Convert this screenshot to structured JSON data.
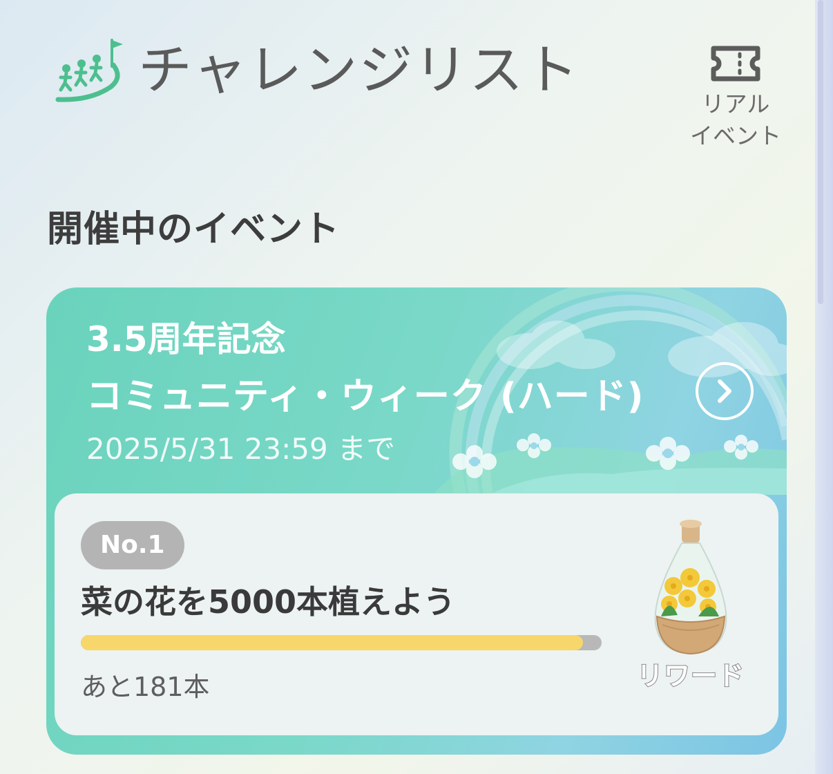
{
  "header": {
    "title": "チャレンジリスト",
    "real_event_label": "リアル\nイベント"
  },
  "section": {
    "title": "開催中のイベント"
  },
  "event": {
    "subtitle": "3.5周年記念",
    "name": "コミュニティ・ウィーク (ハード)",
    "deadline": "2025/5/31 23:59 まで",
    "challenge": {
      "badge": "No.1",
      "title": "菜の花を5000本植えよう",
      "remaining": "あと181本",
      "progress_fraction": 0.964,
      "reward_label": "リワード"
    }
  },
  "colors": {
    "accent_green": "#4dbf8f",
    "card_teal": "#6ad3bc",
    "progress_yellow": "#f7d76c",
    "progress_track": "#b8b8b8",
    "badge_gray": "#b4b4b4"
  },
  "icons": {
    "logo": "walkers-flag-icon",
    "real_event": "ticket-icon",
    "event_open": "chevron-right-icon",
    "reward": "flower-terrarium-icon"
  }
}
